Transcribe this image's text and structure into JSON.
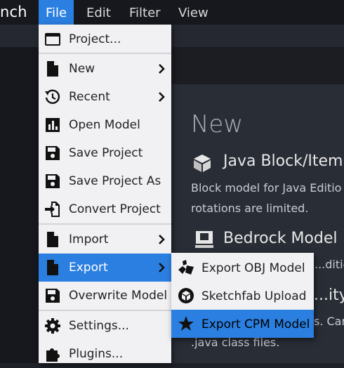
{
  "menubar": {
    "app_name": "nch",
    "items": [
      "File",
      "Edit",
      "Filter",
      "View"
    ]
  },
  "start_screen": {
    "title": "New",
    "formats": [
      {
        "name": "Java Block/Item",
        "icon": "block-icon",
        "desc_lines": [
          "Block model for Java Editio",
          "rotations are limited."
        ]
      },
      {
        "name": "Bedrock Model",
        "icon": "bedrock-icon",
        "desc_lines": [
          "...dition"
        ]
      },
      {
        "name": "...ity",
        "icon": "",
        "desc_lines": [
          "s. Car",
          ".java class files."
        ]
      }
    ]
  },
  "file_menu": {
    "items": [
      {
        "label": "Project...",
        "icon": "window-icon",
        "submenu": false
      },
      {
        "label": "New",
        "icon": "file-icon",
        "submenu": true
      },
      {
        "label": "Recent",
        "icon": "history-icon",
        "submenu": true
      },
      {
        "label": "Open Model",
        "icon": "chart-icon",
        "submenu": false
      },
      {
        "label": "Save Project",
        "icon": "save-icon",
        "submenu": false
      },
      {
        "label": "Save Project As",
        "icon": "save-icon",
        "submenu": false
      },
      {
        "label": "Convert Project",
        "icon": "convert-icon",
        "submenu": false
      },
      {
        "label": "Import",
        "icon": "file-icon",
        "submenu": true
      },
      {
        "label": "Export",
        "icon": "file-icon",
        "submenu": true
      },
      {
        "label": "Overwrite Model",
        "icon": "save-icon",
        "submenu": false
      },
      {
        "label": "Settings...",
        "icon": "gear-icon",
        "submenu": false
      },
      {
        "label": "Plugins...",
        "icon": "puzzle-icon",
        "submenu": false
      }
    ]
  },
  "export_submenu": {
    "items": [
      {
        "label": "Export OBJ Model",
        "icon": "shapes-icon"
      },
      {
        "label": "Sketchfab Upload",
        "icon": "sketchfab-icon"
      },
      {
        "label": "Export CPM Model",
        "icon": "star-icon"
      }
    ]
  },
  "colors": {
    "accent": "#2b7fe0",
    "menu_bg": "#f1f1f4",
    "app_bg": "#1e2127"
  }
}
